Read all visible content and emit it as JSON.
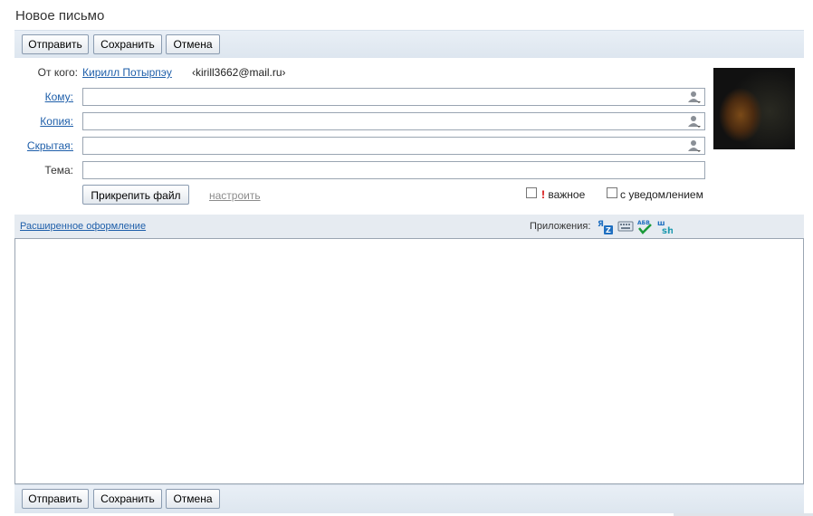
{
  "page": {
    "title": "Новое письмо"
  },
  "toolbar": {
    "send_label": "Отправить",
    "save_label": "Сохранить",
    "cancel_label": "Отмена"
  },
  "header": {
    "from_label": "От кого:",
    "from_name": "Кирилл Потырпэу",
    "from_email": "‹kirill3662@mail.ru›",
    "to_label": "Кому:",
    "cc_label": "Копия:",
    "bcc_label": "Скрытая:",
    "subject_label": "Тема:",
    "to_value": "",
    "cc_value": "",
    "bcc_value": "",
    "subject_value": "",
    "attach_label": "Прикрепить файл",
    "configure_label": "настроить",
    "important_label": "важное",
    "important_mark": "!",
    "important_checked": false,
    "notify_label": "с уведомлением",
    "notify_checked": false
  },
  "apps_bar": {
    "rich_format_label": "Расширенное оформление",
    "apps_label": "Приложения:",
    "apps": [
      "translate-icon",
      "keyboard-icon",
      "spellcheck-icon",
      "transliterate-icon"
    ]
  },
  "editor": {
    "body_value": ""
  },
  "colors": {
    "link": "#1f5faa",
    "toolbar": "#dde6ef",
    "important": "#d40000"
  }
}
